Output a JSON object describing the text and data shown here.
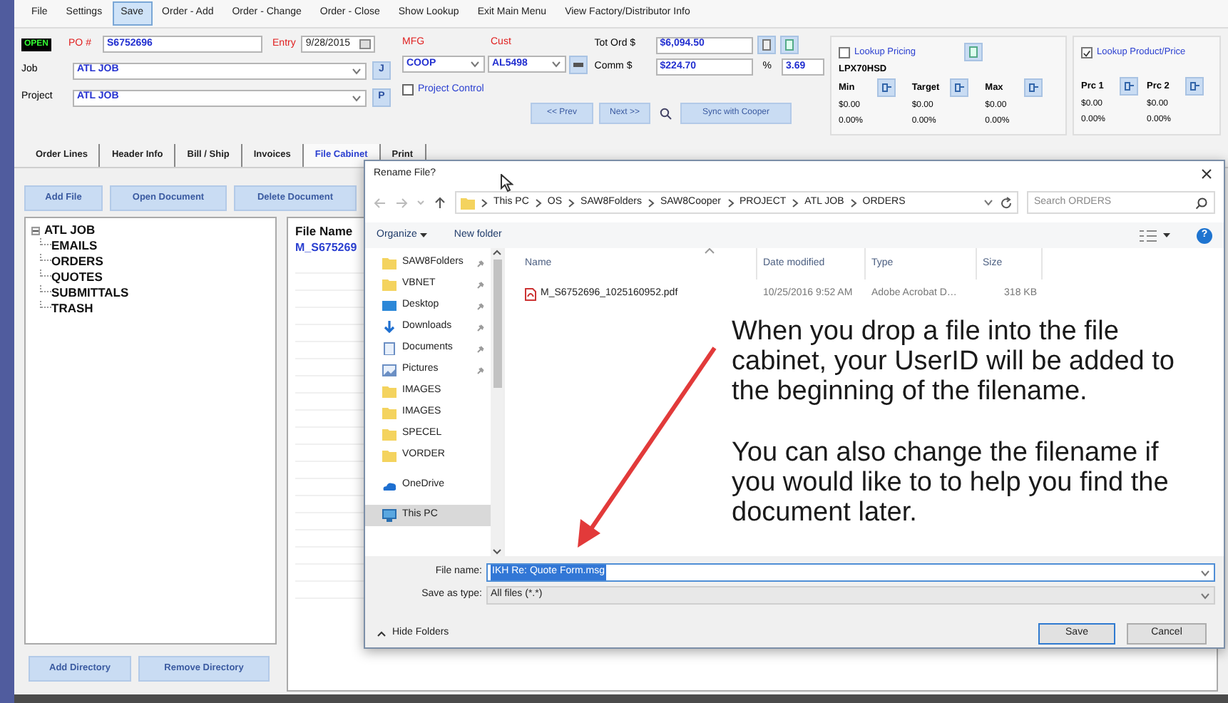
{
  "menu": [
    {
      "label": "File",
      "selected": false
    },
    {
      "label": "Settings",
      "selected": false
    },
    {
      "label": "Save",
      "selected": true
    },
    {
      "label": "Order - Add",
      "selected": false
    },
    {
      "label": "Order - Change",
      "selected": false
    },
    {
      "label": "Order - Close",
      "selected": false
    },
    {
      "label": "Show Lookup",
      "selected": false
    },
    {
      "label": "Exit Main Menu",
      "selected": false
    },
    {
      "label": "View Factory/Distributor Info",
      "selected": false
    }
  ],
  "header": {
    "status": {
      "label": "OPEN",
      "kind": "open"
    },
    "po": {
      "label": "PO #",
      "value": "S6752696"
    },
    "entry": {
      "label": "Entry",
      "value": "9/28/2015"
    },
    "job": {
      "label": "Job",
      "value": "ATL JOB",
      "button": "J"
    },
    "project": {
      "label": "Project",
      "value": "ATL JOB",
      "button": "P"
    },
    "mfg": {
      "label": "MFG",
      "value": "COOP"
    },
    "cust": {
      "label": "Cust",
      "value": "AL5498"
    },
    "project_control": {
      "label": "Project Control",
      "checked": false
    },
    "prev": "<< Prev",
    "next": "Next >>",
    "sync": "Sync with Cooper",
    "tot_ord": {
      "label": "Tot Ord $",
      "value": "$6,094.50"
    },
    "comm": {
      "label": "Comm $",
      "value": "$224.70",
      "pct_label": "%",
      "pct_value": "3.69"
    }
  },
  "lookup_pricing": {
    "label": "Lookup Pricing",
    "checked": false,
    "part": "LPX70HSD",
    "columns": [
      {
        "label": "Min",
        "price": "$0.00",
        "percent": "0.00%"
      },
      {
        "label": "Target",
        "price": "$0.00",
        "percent": "0.00%"
      },
      {
        "label": "Max",
        "price": "$0.00",
        "percent": "0.00%"
      }
    ]
  },
  "lookup_product": {
    "label": "Lookup Product/Price",
    "checked": true,
    "columns": [
      {
        "label": "Prc 1",
        "price": "$0.00",
        "percent": "0.00%"
      },
      {
        "label": "Prc 2",
        "price": "$0.00",
        "percent": "0.00%"
      }
    ]
  },
  "tabs": [
    {
      "label": "Order Lines",
      "selected": false
    },
    {
      "label": "Header Info",
      "selected": false
    },
    {
      "label": "Bill / Ship",
      "selected": false
    },
    {
      "label": "Invoices",
      "selected": false
    },
    {
      "label": "File Cabinet",
      "selected": true
    },
    {
      "label": "Print",
      "selected": false
    }
  ],
  "toolbar": [
    "Add File",
    "Open Document",
    "Delete Document"
  ],
  "tree": {
    "label": "ATL JOB",
    "expanded": true,
    "children": [
      {
        "label": "EMAILS"
      },
      {
        "label": "ORDERS"
      },
      {
        "label": "QUOTES"
      },
      {
        "label": "SUBMITTALS"
      },
      {
        "label": "TRASH"
      }
    ]
  },
  "file_list": {
    "column": "File Name",
    "rows": [
      "M_S675269"
    ]
  },
  "directory_buttons": [
    "Add Directory",
    "Remove Directory"
  ],
  "dialog": {
    "title": "Rename File?",
    "path": [
      "This PC",
      "OS",
      "SAW8Folders",
      "SAW8Cooper",
      "PROJECT",
      "ATL JOB",
      "ORDERS"
    ],
    "search": {
      "placeholder": "Search ORDERS"
    },
    "organize": "Organize",
    "new_folder": "New folder",
    "help": "?",
    "nav": [
      {
        "label": "SAW8Folders",
        "kind": "folder",
        "pinned": true,
        "selected": false
      },
      {
        "label": "VBNET",
        "kind": "folder",
        "pinned": true,
        "selected": false
      },
      {
        "label": "Desktop",
        "kind": "desktop",
        "pinned": true,
        "selected": false
      },
      {
        "label": "Downloads",
        "kind": "downloads",
        "pinned": true,
        "selected": false
      },
      {
        "label": "Documents",
        "kind": "documents",
        "pinned": true,
        "selected": false
      },
      {
        "label": "Pictures",
        "kind": "pictures",
        "pinned": true,
        "selected": false
      },
      {
        "label": "IMAGES",
        "kind": "folder",
        "pinned": false,
        "selected": false
      },
      {
        "label": "IMAGES",
        "kind": "folder",
        "pinned": false,
        "selected": false
      },
      {
        "label": "SPECEL",
        "kind": "folder",
        "pinned": false,
        "selected": false
      },
      {
        "label": "VORDER",
        "kind": "folder",
        "pinned": false,
        "selected": false
      },
      {
        "label": "OneDrive",
        "kind": "onedrive",
        "pinned": false,
        "selected": false
      },
      {
        "label": "This PC",
        "kind": "pc",
        "pinned": false,
        "selected": true
      }
    ],
    "columns": [
      "Name",
      "Date modified",
      "Type",
      "Size"
    ],
    "files": [
      {
        "name": "M_S6752696_1025160952.pdf",
        "date": "10/25/2016 9:52 AM",
        "type": "Adobe Acrobat D…",
        "size": "318 KB"
      }
    ],
    "file_name": {
      "label": "File name:",
      "value": "IKH Re: Quote Form.msg",
      "selected": true
    },
    "save_type": {
      "label": "Save as type:",
      "value": "All files (*.*)"
    },
    "hide_folders": "Hide Folders",
    "buttons": [
      "Save",
      "Cancel"
    ]
  },
  "annotation": [
    "When you drop a file into the file cabinet, your UserID will be added to the beginning of the filename.",
    "You can also change the filename if you would like to to help you find the document later."
  ]
}
